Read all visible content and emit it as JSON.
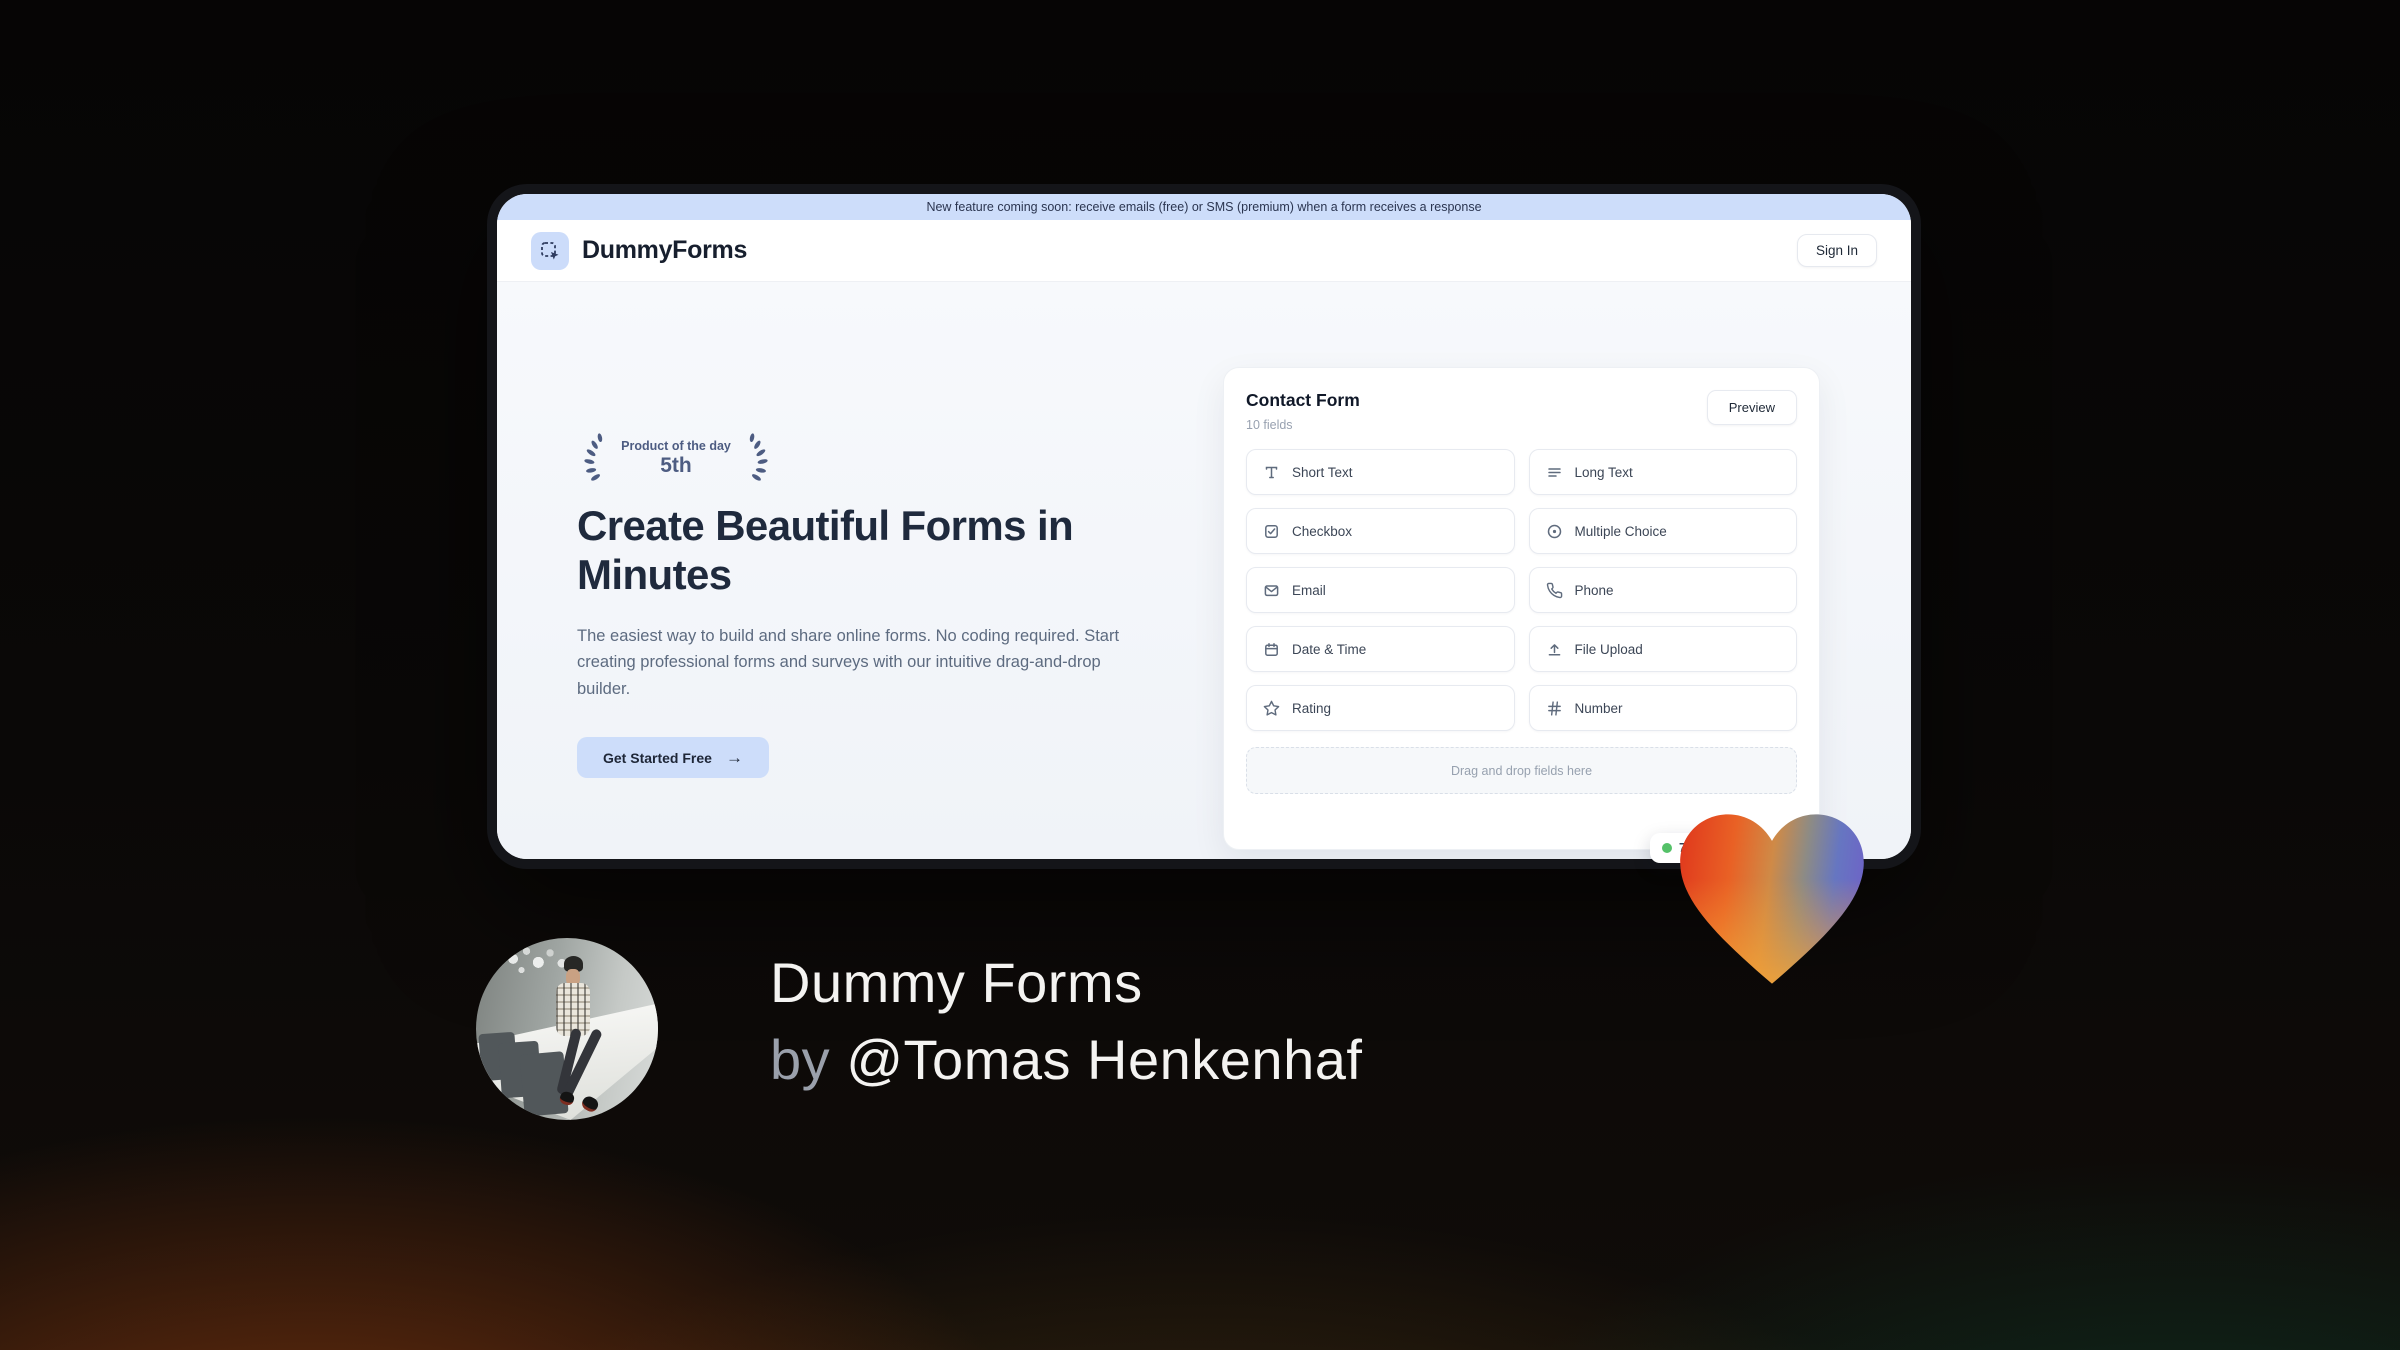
{
  "banner": {
    "text": "New feature coming soon: receive emails (free) or SMS (premium) when a form receives a response"
  },
  "header": {
    "brand": "DummyForms",
    "sign_in_label": "Sign In"
  },
  "hero": {
    "badge": {
      "line1": "Product of the day",
      "line2": "5th"
    },
    "title": "Create Beautiful Forms in Minutes",
    "subtitle": "The easiest way to build and share online forms. No coding required. Start creating professional forms and surveys with our intuitive drag-and-drop builder.",
    "cta_label": "Get Started Free",
    "cta_arrow": "→"
  },
  "form_card": {
    "title": "Contact Form",
    "subtitle": "10 fields",
    "preview_label": "Preview",
    "fields": [
      {
        "label": "Short Text",
        "icon": "text-icon"
      },
      {
        "label": "Long Text",
        "icon": "paragraph-lines-icon"
      },
      {
        "label": "Checkbox",
        "icon": "checkbox-icon"
      },
      {
        "label": "Multiple Choice",
        "icon": "radio-button-icon"
      },
      {
        "label": "Email",
        "icon": "envelope-icon"
      },
      {
        "label": "Phone",
        "icon": "phone-icon"
      },
      {
        "label": "Date & Time",
        "icon": "calendar-icon"
      },
      {
        "label": "File Upload",
        "icon": "upload-icon"
      },
      {
        "label": "Rating",
        "icon": "star-icon"
      },
      {
        "label": "Number",
        "icon": "hash-icon"
      }
    ],
    "dropzone_text": "Drag and drop fields here",
    "status_badge": {
      "text": "7",
      "dot_color": "#54c168"
    }
  },
  "footer": {
    "title": "Dummy Forms",
    "byline_prefix": "by ",
    "byline_handle": "@Tomas Henkenhaf"
  },
  "colors": {
    "accent_light_blue": "#cdddfa",
    "navy_text": "#1f2a3d",
    "laurel": "#4d5c82",
    "window_frame": "#141519",
    "heart_red": "#e03a1d",
    "heart_orange": "#f5a335",
    "heart_blue": "#6d65c6",
    "status_green": "#54c168"
  }
}
